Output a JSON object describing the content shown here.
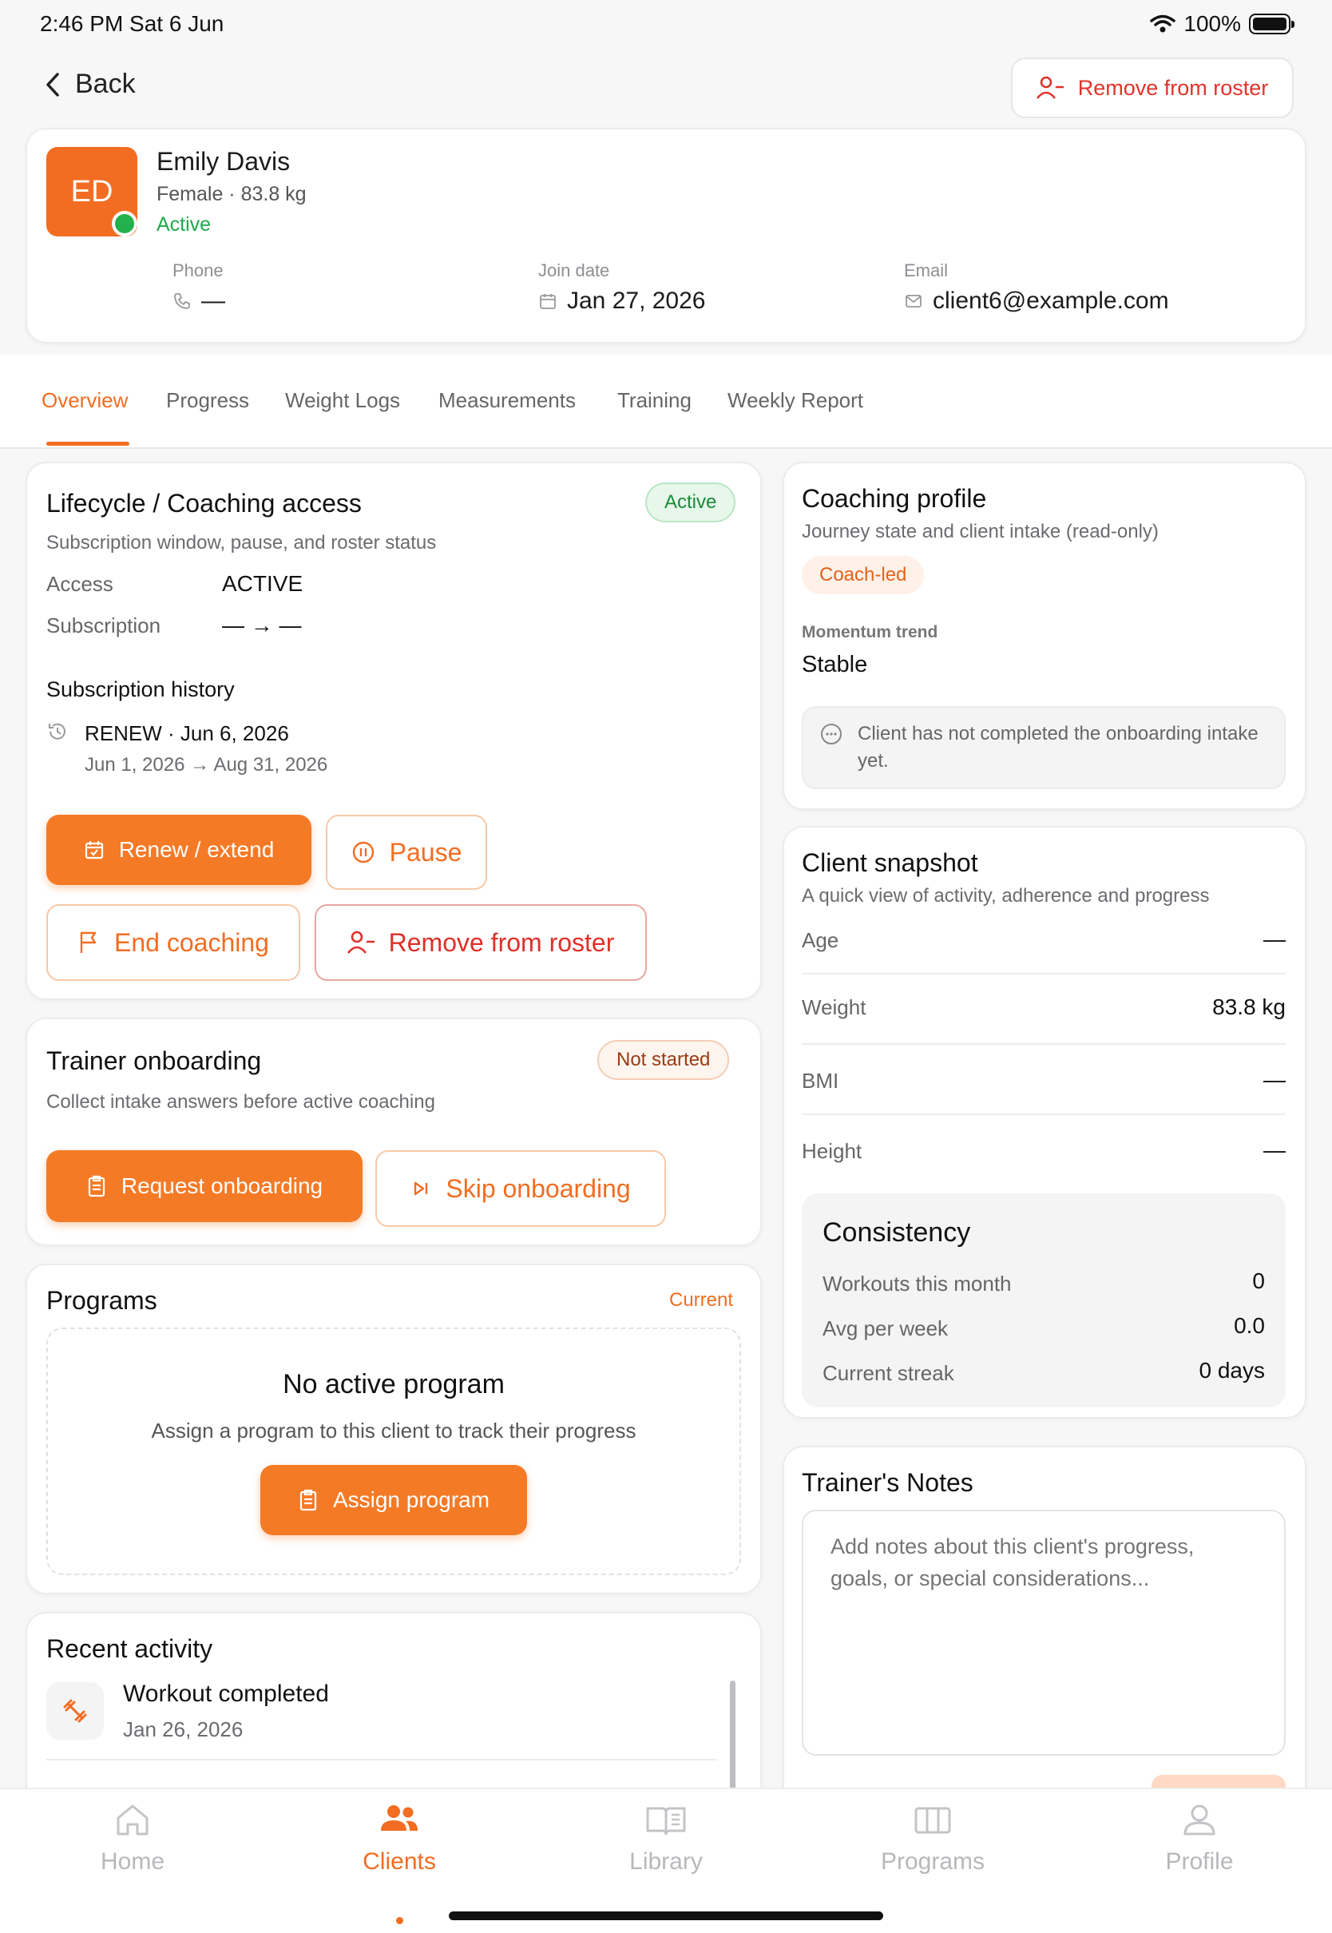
{
  "status_bar": {
    "time": "2:46 PM   Sat 6 Jun",
    "battery": "100%"
  },
  "header": {
    "back_label": "Back",
    "remove_label": "Remove from roster"
  },
  "client": {
    "initials": "ED",
    "name": "Emily Davis",
    "meta": "Female · 83.8 kg",
    "status": "Active",
    "phone_label": "Phone",
    "phone_value": "—",
    "join_label": "Join date",
    "join_value": "Jan 27, 2026",
    "email_label": "Email",
    "email_value": "client6@example.com"
  },
  "tabs": [
    "Overview",
    "Progress",
    "Weight Logs",
    "Measurements",
    "Training",
    "Weekly Report"
  ],
  "lifecycle": {
    "title": "Lifecycle / Coaching access",
    "badge": "Active",
    "subtitle": "Subscription window, pause, and roster status",
    "access_label": "Access",
    "access_value": "ACTIVE",
    "subscription_label": "Subscription",
    "subscription_value": "— → —",
    "history_title": "Subscription history",
    "history_entry": "RENEW · Jun 6, 2026",
    "history_range": "Jun 1, 2026 → Aug 31, 2026",
    "renew_label": "Renew / extend",
    "pause_label": "Pause",
    "end_label": "End coaching",
    "remove_label": "Remove from roster"
  },
  "onboarding": {
    "title": "Trainer onboarding",
    "badge": "Not started",
    "subtitle": "Collect intake answers before active coaching",
    "request_label": "Request onboarding",
    "skip_label": "Skip onboarding"
  },
  "programs": {
    "title": "Programs",
    "link": "Current",
    "empty_title": "No active program",
    "empty_text": "Assign a program to this client to track their progress",
    "assign_label": "Assign program"
  },
  "activity": {
    "title": "Recent activity",
    "item_title": "Workout completed",
    "item_date": "Jan 26, 2026"
  },
  "coaching_profile": {
    "title": "Coaching profile",
    "subtitle": "Journey state and client intake (read-only)",
    "tag": "Coach-led",
    "momentum_label": "Momentum trend",
    "momentum_value": "Stable",
    "notice": "Client has not completed the onboarding intake yet."
  },
  "snapshot": {
    "title": "Client snapshot",
    "subtitle": "A quick view of activity, adherence and progress",
    "rows": [
      {
        "label": "Age",
        "value": "—"
      },
      {
        "label": "Weight",
        "value": "83.8 kg"
      },
      {
        "label": "BMI",
        "value": "—"
      },
      {
        "label": "Height",
        "value": "—"
      }
    ],
    "consistency": {
      "title": "Consistency",
      "rows": [
        {
          "label": "Workouts this month",
          "value": "0"
        },
        {
          "label": "Avg per week",
          "value": "0.0"
        },
        {
          "label": "Current streak",
          "value": "0 days"
        }
      ]
    }
  },
  "notes": {
    "title": "Trainer's Notes",
    "placeholder": "Add notes about this client's progress, goals, or special considerations..."
  },
  "bottom_nav": [
    {
      "label": "Home",
      "icon": "home-icon"
    },
    {
      "label": "Clients",
      "icon": "users-icon"
    },
    {
      "label": "Library",
      "icon": "book-icon"
    },
    {
      "label": "Programs",
      "icon": "columns-icon"
    },
    {
      "label": "Profile",
      "icon": "user-icon"
    }
  ],
  "colors": {
    "accent": "#f26d21",
    "danger": "#df2f28",
    "success": "#1faa4a"
  }
}
